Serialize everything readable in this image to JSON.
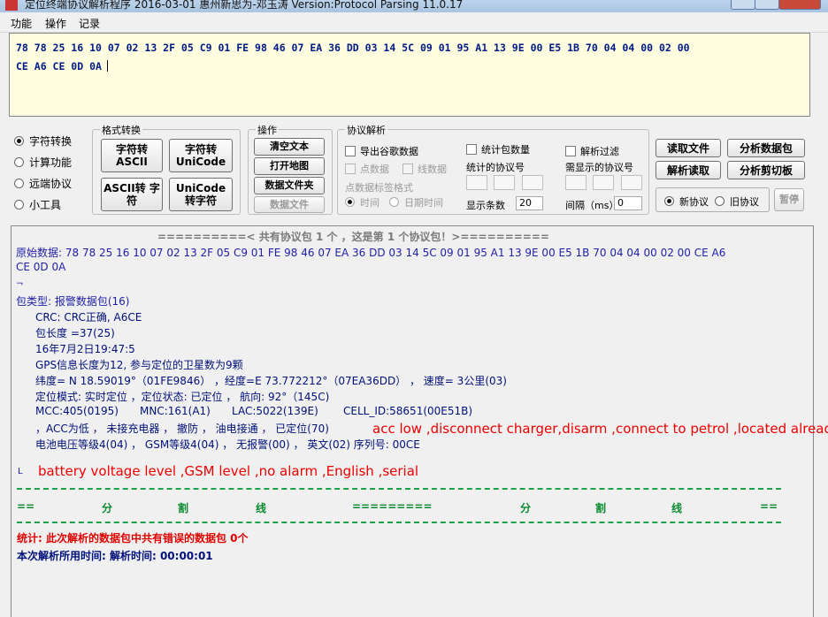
{
  "window": {
    "title": "定位终端协议解析程序 2016-03-01   惠州新思为-邓玉涛      Version:Protocol Parsing 11.0.17"
  },
  "menu": [
    "功能",
    "操作",
    "记录"
  ],
  "hex_input": {
    "line1": "78 78 25 16 10 07 02 13 2F 05 C9 01 FE 98 46 07 EA 36 DD 03 14 5C 09 01 95 A1 13 9E 00 E5 1B 70 04 04 00 02 00",
    "line2": "CE A6 CE 0D 0A"
  },
  "mode_radios": [
    {
      "label": "字符转换",
      "selected": true
    },
    {
      "label": "计算功能",
      "selected": false
    },
    {
      "label": "远端协议",
      "selected": false
    },
    {
      "label": "小工具",
      "selected": false
    }
  ],
  "format_group": {
    "title": "格式转换",
    "buttons": [
      "字符转 ASCII",
      "字符转 UniCode",
      "ASCII转 字符",
      "UniCode 转字符"
    ]
  },
  "operate_group": {
    "title": "操作",
    "buttons": [
      "清空文本",
      "打开地图",
      "数据文件夹",
      "数据文件"
    ]
  },
  "protocol_group": {
    "title": "协议解析",
    "export_google": "导出谷歌数据",
    "point_data": "点数据",
    "line_data": "线数据",
    "marker_format": "点数据标签格式",
    "radio_time": "时间",
    "radio_date_time": "日期时间",
    "stat_packets": "统计包数量",
    "stat_protocol": "统计的协议号",
    "show_count_label": "显示条数",
    "show_count_value": "20",
    "parse_filter": "解析过滤",
    "show_protocol": "需显示的协议号",
    "interval_label": "间隔（ms）",
    "interval_value": "0"
  },
  "right_buttons": {
    "read_file": "读取文件",
    "analyze_packet": "分析数据包",
    "parse_read": "解析读取",
    "analyze_clipboard": "分析剪切板",
    "new_protocol": "新协议",
    "old_protocol": "旧协议",
    "pause": "暂停"
  },
  "output": {
    "header": "==========< 共有协议包 1 个 ，这是第 1 个协议包！>==========",
    "raw_line1": "原始数据: 78 78 25 16 10 07 02 13 2F 05 C9 01 FE 98 46 07 EA 36 DD 03 14 5C 09 01 95 A1 13 9E 00 E5 1B 70 04 04 00 02 00 CE A6",
    "raw_line2": "CE 0D 0A",
    "mark1": "¬",
    "packet_type": "包类型: 报警数据包(16)",
    "crc": "CRC: CRC正确, A6CE",
    "length": "包长度  =37(25)",
    "datetime": "16年7月2日19:47:5",
    "gps_info": "GPS信息长度为12, 参与定位的卫星数为9颗",
    "coords": "纬度= N 18.59019°（01FE9846） ，经度=E 73.772212°（07EA36DD） ， 速度= 3公里(03)",
    "location": "定位模式: 实时定位    ，定位状态: 已定位  ， 航向: 92°（145C)",
    "cell_mcc": "MCC:405(0195)",
    "cell_mnc": "MNC:161(A1)",
    "cell_lac": "LAC:5022(139E)",
    "cell_id": "CELL_ID:58651(00E51B)",
    "status": "，ACC为低 ， 未接充电器 ， 撤防 ， 油电接通 ， 已定位(70)",
    "battery": "电池电压等级4(04) ， GSM等级4(04) ， 无报警(00) ， 英文(02)    序列号: 00CE",
    "mark2": "L",
    "annotation1": "acc low ,disconnect charger,disarm ,connect to petrol ,located already",
    "annotation2": "battery voltage level ,GSM level ,no alarm ,English ,serial",
    "divider_left": "==",
    "divider_w1": "分",
    "divider_w2": "割",
    "divider_w3": "线",
    "divider_mid": "=========",
    "divider_right": "==",
    "stat_line": "统计: 此次解析的数据包中共有错误的数据包 0个",
    "time_line": "本次解析所用时间:  解析时间: 00:00:01"
  }
}
